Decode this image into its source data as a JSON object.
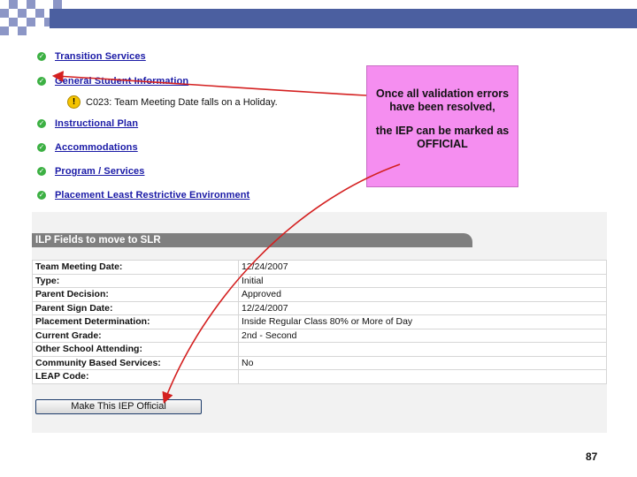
{
  "slide": {
    "page_number": "87",
    "accent_colors": {
      "bar": "#4b5fa0",
      "checker": "#8c96c6"
    }
  },
  "screen": {
    "sections": [
      {
        "label": "Transition Services",
        "status_icon": "check-icon"
      },
      {
        "label": "General Student Information",
        "status_icon": "check-icon"
      },
      {
        "label": "Instructional Plan",
        "status_icon": "check-icon"
      },
      {
        "label": "Accommodations",
        "status_icon": "check-icon"
      },
      {
        "label": "Program / Services",
        "status_icon": "check-icon"
      },
      {
        "label": "Placement Least Restrictive Environment",
        "status_icon": "check-icon"
      }
    ],
    "warning": {
      "icon": "exclamation-icon",
      "text": "C023: Team Meeting Date falls on a Holiday."
    },
    "callout": {
      "line1": "Once all validation errors have been resolved,",
      "line2": "the IEP can be marked as OFFICIAL",
      "color": "#f58ef0"
    },
    "fields_header": "ILP Fields to move to SLR",
    "fields": [
      {
        "label": "Team Meeting Date:",
        "value": "12/24/2007"
      },
      {
        "label": "Type:",
        "value": "Initial"
      },
      {
        "label": "Parent Decision:",
        "value": "Approved"
      },
      {
        "label": "Parent Sign Date:",
        "value": "12/24/2007"
      },
      {
        "label": "Placement Determination:",
        "value": "Inside Regular Class 80% or More of Day"
      },
      {
        "label": "Current Grade:",
        "value": "2nd - Second"
      },
      {
        "label": "Other School Attending:",
        "value": ""
      },
      {
        "label": "Community Based Services:",
        "value": "No"
      },
      {
        "label": "LEAP Code:",
        "value": ""
      }
    ],
    "official_button": "Make This IEP Official",
    "annotation_color": "#d42020"
  }
}
